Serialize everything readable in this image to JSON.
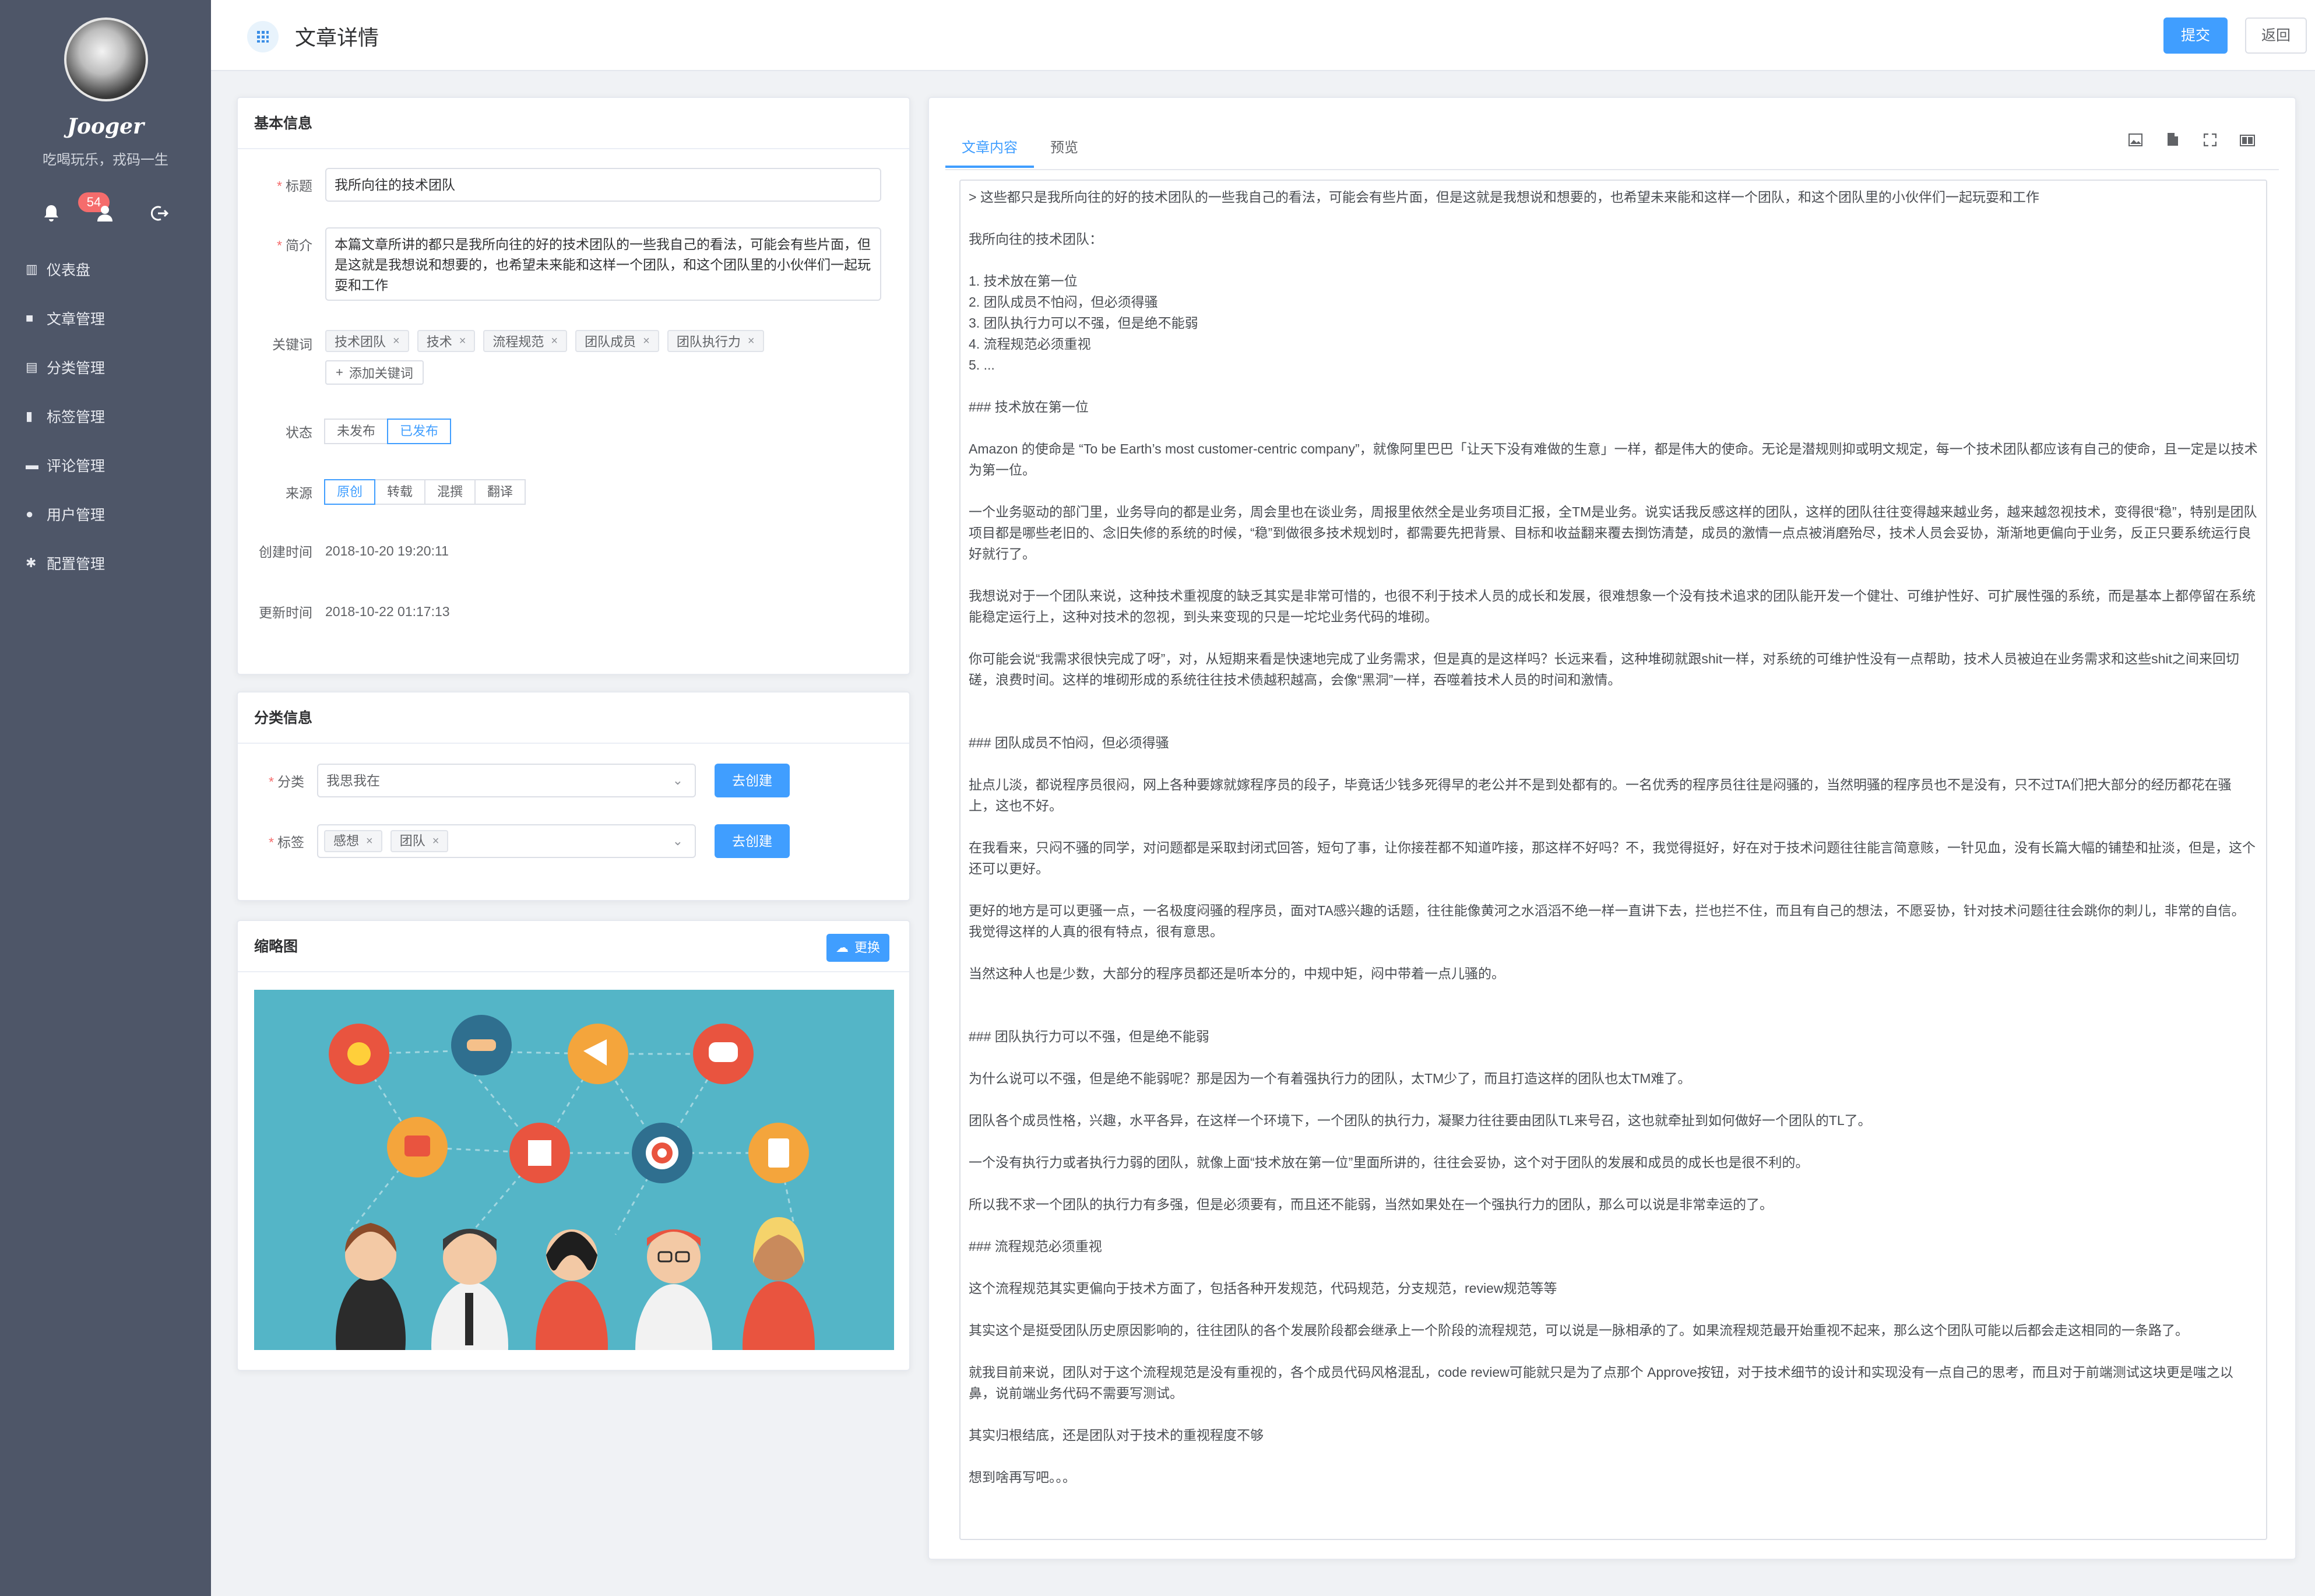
{
  "sidebar": {
    "brand": "Jooger",
    "motto": "吃喝玩乐，戎码一生",
    "badge_count": "54",
    "icons": [
      "bell-icon",
      "user-icon",
      "logout-icon"
    ],
    "items": [
      {
        "label": "仪表盘",
        "icon": "dashboard-icon"
      },
      {
        "label": "文章管理",
        "icon": "article-icon"
      },
      {
        "label": "分类管理",
        "icon": "category-icon"
      },
      {
        "label": "标签管理",
        "icon": "tag-icon"
      },
      {
        "label": "评论管理",
        "icon": "comment-icon"
      },
      {
        "label": "用户管理",
        "icon": "users-icon"
      },
      {
        "label": "配置管理",
        "icon": "gear-icon"
      }
    ]
  },
  "header": {
    "title": "文章详情",
    "submit_label": "提交",
    "back_label": "返回"
  },
  "basic": {
    "heading": "基本信息",
    "title_label": "标题",
    "title_value": "我所向往的技术团队",
    "summary_label": "简介",
    "summary_value": "本篇文章所讲的都只是我所向往的好的技术团队的一些我自己的看法，可能会有些片面，但是这就是我想说和想要的，也希望未来能和这样一个团队，和这个团队里的小伙伴们一起玩耍和工作",
    "keywords_label": "关键词",
    "keywords": [
      "技术团队",
      "技术",
      "流程规范",
      "团队成员",
      "团队执行力"
    ],
    "add_keyword": "添加关键词",
    "status_label": "状态",
    "status_options": [
      "未发布",
      "已发布"
    ],
    "status_selected": "已发布",
    "source_label": "来源",
    "source_options": [
      "原创",
      "转载",
      "混撰",
      "翻译"
    ],
    "source_selected": "原创",
    "created_label": "创建时间",
    "created_value": "2018-10-20 19:20:11",
    "updated_label": "更新时间",
    "updated_value": "2018-10-22 01:17:13"
  },
  "category": {
    "heading": "分类信息",
    "category_label": "分类",
    "category_value": "我思我在",
    "tags_label": "标签",
    "tags": [
      "感想",
      "团队"
    ],
    "create_label": "去创建"
  },
  "thumbnail": {
    "heading": "缩略图",
    "change_label": "更换"
  },
  "editor": {
    "tabs": [
      "文章内容",
      "预览"
    ],
    "active_tab": "文章内容",
    "toolbar_icons": [
      "image-icon",
      "file-icon",
      "fullscreen-icon",
      "preview-icon"
    ],
    "lines": [
      "> 这些都只是我所向往的好的技术团队的一些我自己的看法，可能会有些片面，但是这就是我想说和想要的，也希望未来能和这样一个团队，和这个团队里的小伙伴们一起玩耍和工作",
      "",
      "我所向往的技术团队：",
      "",
      "1. 技术放在第一位",
      "2. 团队成员不怕闷，但必须得骚",
      "3. 团队执行力可以不强，但是绝不能弱",
      "4. 流程规范必须重视",
      "5. ...",
      "",
      "### 技术放在第一位",
      "",
      "Amazon 的使命是 “To be Earth’s most customer-centric company”，就像阿里巴巴「让天下没有难做的生意」一样，都是伟大的使命。无论是潜规则抑或明文规定，每一个技术团队都应该有自己的使命，且一定是以技术为第一位。",
      "",
      "一个业务驱动的部门里，业务导向的都是业务，周会里也在谈业务，周报里依然全是业务项目汇报，全TM是业务。说实话我反感这样的团队，这样的团队往往变得越来越业务，越来越忽视技术，变得很“稳”，特别是团队项目都是哪些老旧的、念旧失修的系统的时候，“稳”到做很多技术规划时，都需要先把背景、目标和收益翻来覆去捯饬清楚，成员的激情一点点被消磨殆尽，技术人员会妥协，渐渐地更偏向于业务，反正只要系统运行良好就行了。",
      "",
      "我想说对于一个团队来说，这种技术重视度的缺乏其实是非常可惜的，也很不利于技术人员的成长和发展，很难想象一个没有技术追求的团队能开发一个健壮、可维护性好、可扩展性强的系统，而是基本上都停留在系统能稳定运行上，这种对技术的忽视，到头来变现的只是一坨坨业务代码的堆砌。",
      "",
      "你可能会说“我需求很快完成了呀”，对，从短期来看是快速地完成了业务需求，但是真的是这样吗？长远来看，这种堆砌就跟shit一样，对系统的可维护性没有一点帮助，技术人员被迫在业务需求和这些shit之间来回切磋，浪费时间。这样的堆砌形成的系统往往技术债越积越高，会像“黑洞”一样，吞噬着技术人员的时间和激情。",
      "",
      "",
      "### 团队成员不怕闷，但必须得骚",
      "",
      "扯点儿淡，都说程序员很闷，网上各种要嫁就嫁程序员的段子，毕竟话少钱多死得早的老公并不是到处都有的。一名优秀的程序员往往是闷骚的，当然明骚的程序员也不是没有，只不过TA们把大部分的经历都花在骚上，这也不好。",
      "",
      "在我看来，只闷不骚的同学，对问题都是采取封闭式回答，短句了事，让你接茬都不知道咋接，那这样不好吗？不，我觉得挺好，好在对于技术问题往往能言简意赅，一针见血，没有长篇大幅的铺垫和扯淡，但是，这个还可以更好。",
      "",
      "更好的地方是可以更骚一点，一名极度闷骚的程序员，面对TA感兴趣的话题，往往能像黄河之水滔滔不绝一样一直讲下去，拦也拦不住，而且有自己的想法，不愿妥协，针对技术问题往往会跳你的刺儿，非常的自信。我觉得这样的人真的很有特点，很有意思。",
      "",
      "当然这种人也是少数，大部分的程序员都还是听本分的，中规中矩，闷中带着一点儿骚的。",
      "",
      "",
      "### 团队执行力可以不强，但是绝不能弱",
      "",
      "为什么说可以不强，但是绝不能弱呢？那是因为一个有着强执行力的团队，太TM少了，而且打造这样的团队也太TM难了。",
      "",
      "团队各个成员性格，兴趣，水平各异，在这样一个环境下，一个团队的执行力，凝聚力往往要由团队TL来号召，这也就牵扯到如何做好一个团队的TL了。",
      "",
      "一个没有执行力或者执行力弱的团队，就像上面“技术放在第一位”里面所讲的，往往会妥协，这个对于团队的发展和成员的成长也是很不利的。",
      "",
      "所以我不求一个团队的执行力有多强，但是必须要有，而且还不能弱，当然如果处在一个强执行力的团队，那么可以说是非常幸运的了。",
      "",
      "### 流程规范必须重视",
      "",
      "这个流程规范其实更偏向于技术方面了，包括各种开发规范，代码规范，分支规范，review规范等等",
      "",
      "其实这个是挺受团队历史原因影响的，往往团队的各个发展阶段都会继承上一个阶段的流程规范，可以说是一脉相承的了。如果流程规范最开始重视不起来，那么这个团队可能以后都会走这相同的一条路了。",
      "",
      "就我目前来说，团队对于这个流程规范是没有重视的，各个成员代码风格混乱，code review可能就只是为了点那个 Approve按钮，对于技术细节的设计和实现没有一点自己的思考，而且对于前端测试这块更是嗤之以鼻，说前端业务代码不需要写测试。",
      "",
      "其实归根结底，还是团队对于技术的重视程度不够",
      "",
      "想到啥再写吧。。。"
    ]
  }
}
